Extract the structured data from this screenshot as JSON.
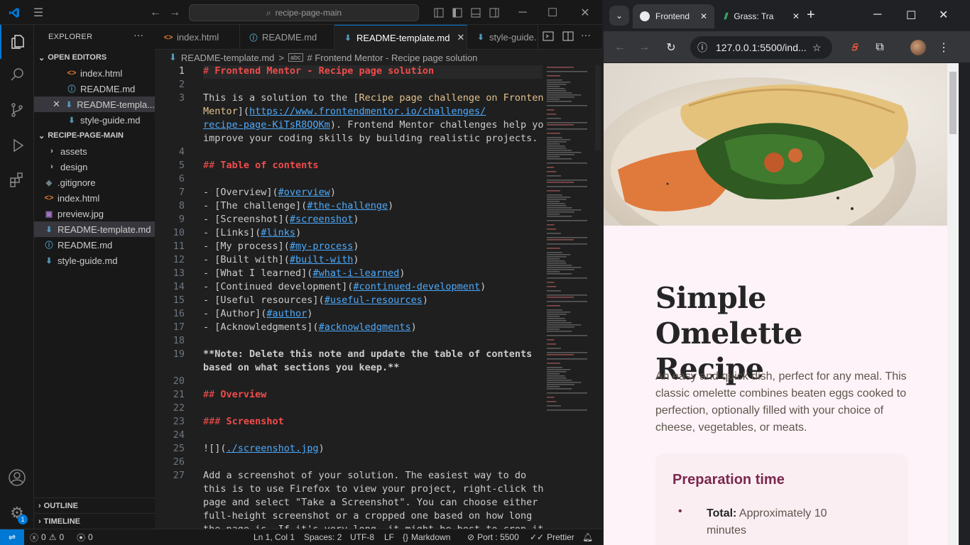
{
  "vscode": {
    "search_text": "recipe-page-main",
    "sidebar_title": "EXPLORER",
    "open_editors_label": "OPEN EDITORS",
    "open_editors": [
      {
        "name": "index.html",
        "icon": "html-file-icon"
      },
      {
        "name": "README.md",
        "icon": "info-icon"
      },
      {
        "name": "README-templa...",
        "icon": "markdown-icon"
      },
      {
        "name": "style-guide.md",
        "icon": "markdown-icon"
      }
    ],
    "folder_label": "RECIPE-PAGE-MAIN",
    "tree": [
      {
        "name": "assets",
        "type": "folder"
      },
      {
        "name": "design",
        "type": "folder"
      },
      {
        "name": ".gitignore",
        "type": "file"
      },
      {
        "name": "index.html",
        "type": "file"
      },
      {
        "name": "preview.jpg",
        "type": "file"
      },
      {
        "name": "README-template.md",
        "type": "file"
      },
      {
        "name": "README.md",
        "type": "file"
      },
      {
        "name": "style-guide.md",
        "type": "file"
      }
    ],
    "outline_label": "OUTLINE",
    "timeline_label": "TIMELINE",
    "tabs": [
      "index.html",
      "README.md",
      "README-template.md",
      "style-guide."
    ],
    "breadcrumb": {
      "file": "README-template.md",
      "sep": ">",
      "symbol": "# Frontend Mentor - Recipe page solution"
    },
    "editor_lines": [
      {
        "n": "1",
        "text": "# Frontend Mentor - Recipe page solution"
      },
      {
        "n": "2",
        "text": ""
      },
      {
        "n": "3",
        "text": "This is a solution to the [Recipe page challenge on Frontend Mentor](https://www.frontendmentor.io/challenges/recipe-page-KiTsR8QQKm). Frontend Mentor challenges help you improve your coding skills by building realistic projects."
      },
      {
        "n": "4",
        "text": ""
      },
      {
        "n": "5",
        "text": "## Table of contents"
      },
      {
        "n": "6",
        "text": ""
      },
      {
        "n": "7",
        "text": "- [Overview](#overview)"
      },
      {
        "n": "8",
        "text": "  - [The challenge](#the-challenge)"
      },
      {
        "n": "9",
        "text": "  - [Screenshot](#screenshot)"
      },
      {
        "n": "10",
        "text": "  - [Links](#links)"
      },
      {
        "n": "11",
        "text": "- [My process](#my-process)"
      },
      {
        "n": "12",
        "text": "  - [Built with](#built-with)"
      },
      {
        "n": "13",
        "text": "  - [What I learned](#what-i-learned)"
      },
      {
        "n": "14",
        "text": "  - [Continued development](#continued-development)"
      },
      {
        "n": "15",
        "text": "  - [Useful resources](#useful-resources)"
      },
      {
        "n": "16",
        "text": "- [Author](#author)"
      },
      {
        "n": "17",
        "text": "- [Acknowledgments](#acknowledgments)"
      },
      {
        "n": "18",
        "text": ""
      },
      {
        "n": "19",
        "text": "**Note: Delete this note and update the table of contents based on what sections you keep.**"
      },
      {
        "n": "20",
        "text": ""
      },
      {
        "n": "21",
        "text": "## Overview"
      },
      {
        "n": "22",
        "text": ""
      },
      {
        "n": "23",
        "text": "### Screenshot"
      },
      {
        "n": "24",
        "text": ""
      },
      {
        "n": "25",
        "text": "![](./screenshot.jpg)"
      },
      {
        "n": "26",
        "text": ""
      },
      {
        "n": "27",
        "text": "Add a screenshot of your solution. The easiest way to do this is to use Firefox to view your project, right-click the page and select \"Take a Screenshot\". You can choose either a full-height screenshot or a cropped one based on how long the page is. If it's very long, it might be best to crop it."
      }
    ],
    "status": {
      "errors": "0",
      "warnings": "0",
      "ports": "0",
      "position": "Ln 1, Col 1",
      "spaces": "Spaces: 2",
      "encoding": "UTF-8",
      "eol": "LF",
      "language": "Markdown",
      "port": "Port : 5500",
      "formatter": "Prettier",
      "settings_badge": "1"
    }
  },
  "chrome": {
    "tabs": [
      {
        "title": "Frontend"
      },
      {
        "title": "Grass: Tra"
      }
    ],
    "url": "127.0.0.1:5500/ind...",
    "page": {
      "title": "Simple Omelette Recipe",
      "description": "An easy and quick dish, perfect for any meal. This classic omelette combines beaten eggs cooked to perfection, optionally filled with your choice of cheese, vegetables, or meats.",
      "prep_title": "Preparation time",
      "prep_item_label": "Total:",
      "prep_item_value": "Approximately 10 minutes"
    }
  },
  "colors": {
    "vscode_bg": "#1f1f1f",
    "accent": "#0078d4",
    "heading_red": "#f14c4c",
    "link_blue": "#4daafc",
    "recipe_bg": "#fdf3f8",
    "recipe_accent": "#7a284e"
  }
}
